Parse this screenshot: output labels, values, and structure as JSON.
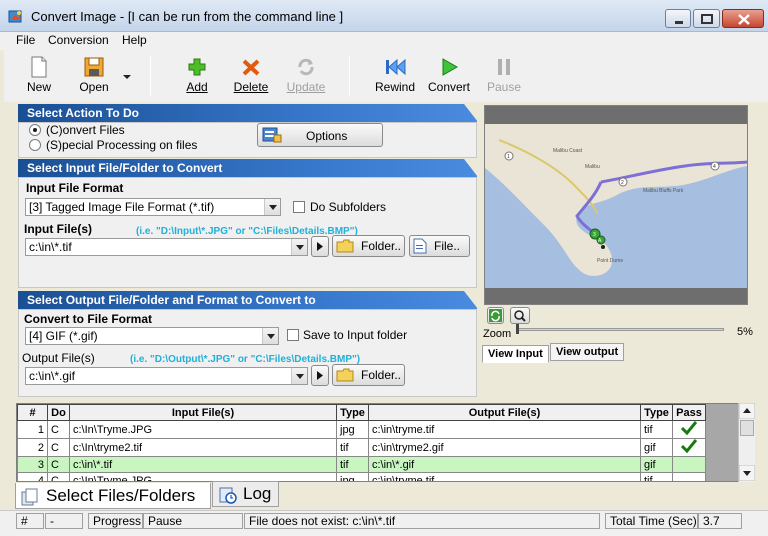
{
  "window": {
    "title": "Convert Image - [I can be run from the command line ]"
  },
  "menu": [
    "File",
    "Conversion",
    "Help"
  ],
  "toolbar": {
    "new": "New",
    "open": "Open",
    "add": "Add",
    "delete": "Delete",
    "update": "Update",
    "rewind": "Rewind",
    "convert": "Convert",
    "pause": "Pause"
  },
  "action": {
    "header": "Select Action To Do",
    "convert_files": "(C)onvert Files",
    "special": "(S)pecial Processing on files",
    "options": "Options"
  },
  "input": {
    "header": "Select Input File/Folder to Convert",
    "format_label": "Input File Format",
    "format_value": "[3] Tagged Image File Format (*.tif)",
    "subfolders": "Do Subfolders",
    "files_label": "Input File(s)",
    "hint": "(i.e. \"D:\\Input\\*.JPG\"  or \"C:\\Files\\Details.BMP\")",
    "files_value": "c:\\in\\*.tif",
    "folder_btn": "Folder..",
    "file_btn": "File.."
  },
  "output": {
    "header": "Select Output File/Folder and Format to Convert to",
    "format_label": "Convert to File Format",
    "format_value": "[4] GIF (*.gif)",
    "save_to_input": "Save to Input folder",
    "files_label": "Output File(s)",
    "hint": "(i.e. \"D:\\Output\\*.JPG\"  or \"C:\\Files\\Details.BMP\")",
    "files_value": "c:\\in\\*.gif",
    "folder_btn": "Folder.."
  },
  "preview": {
    "zoom_label": "Zoom",
    "zoom_value": "5%",
    "zoom_fraction": 0.0,
    "tab_input": "View Input",
    "tab_output": "View output",
    "map_labels": [
      "Malibu Coast",
      "Malibu Bluffs Park",
      "Point Dume",
      "Malibu",
      "1",
      "2",
      "3",
      "4",
      "A"
    ]
  },
  "grid": {
    "columns": [
      "#",
      "Do",
      "Input File(s)",
      "Type",
      "Output File(s)",
      "Type",
      "Pass"
    ],
    "rows": [
      {
        "n": "1",
        "do": "C",
        "in": "c:\\In\\Tryme.JPG",
        "t1": "jpg",
        "out": "c:\\in\\tryme.tif",
        "t2": "tif",
        "pass": "check"
      },
      {
        "n": "2",
        "do": "C",
        "in": "c:\\In\\tryme2.tif",
        "t1": "tif",
        "out": "c:\\in\\tryme2.gif",
        "t2": "gif",
        "pass": "check"
      },
      {
        "n": "3",
        "do": "C",
        "in": "c:\\in\\*.tif",
        "t1": "tif",
        "out": "c:\\in\\*.gif",
        "t2": "gif",
        "pass": ""
      },
      {
        "n": "4",
        "do": "C",
        "in": "c:\\In\\Tryme.JPG",
        "t1": "jpg",
        "out": "c:\\in\\tryme.tif",
        "t2": "tif",
        "pass": ""
      }
    ],
    "selected_row": 2
  },
  "bottom_tabs": {
    "select": "Select Files/Folders",
    "log": "Log"
  },
  "status": {
    "hash": "#",
    "dash": "-",
    "progress_label": "Progress:",
    "progress_value": "Pause",
    "message": "File does not exist: c:\\in\\*.tif",
    "time_label": "Total Time (Sec):",
    "time_value": "3.7"
  },
  "colors": {
    "section_header": "#1a4f94",
    "hint": "#20b0d8",
    "selected_row": "#c8f5c0",
    "check": "#1a7a10"
  }
}
